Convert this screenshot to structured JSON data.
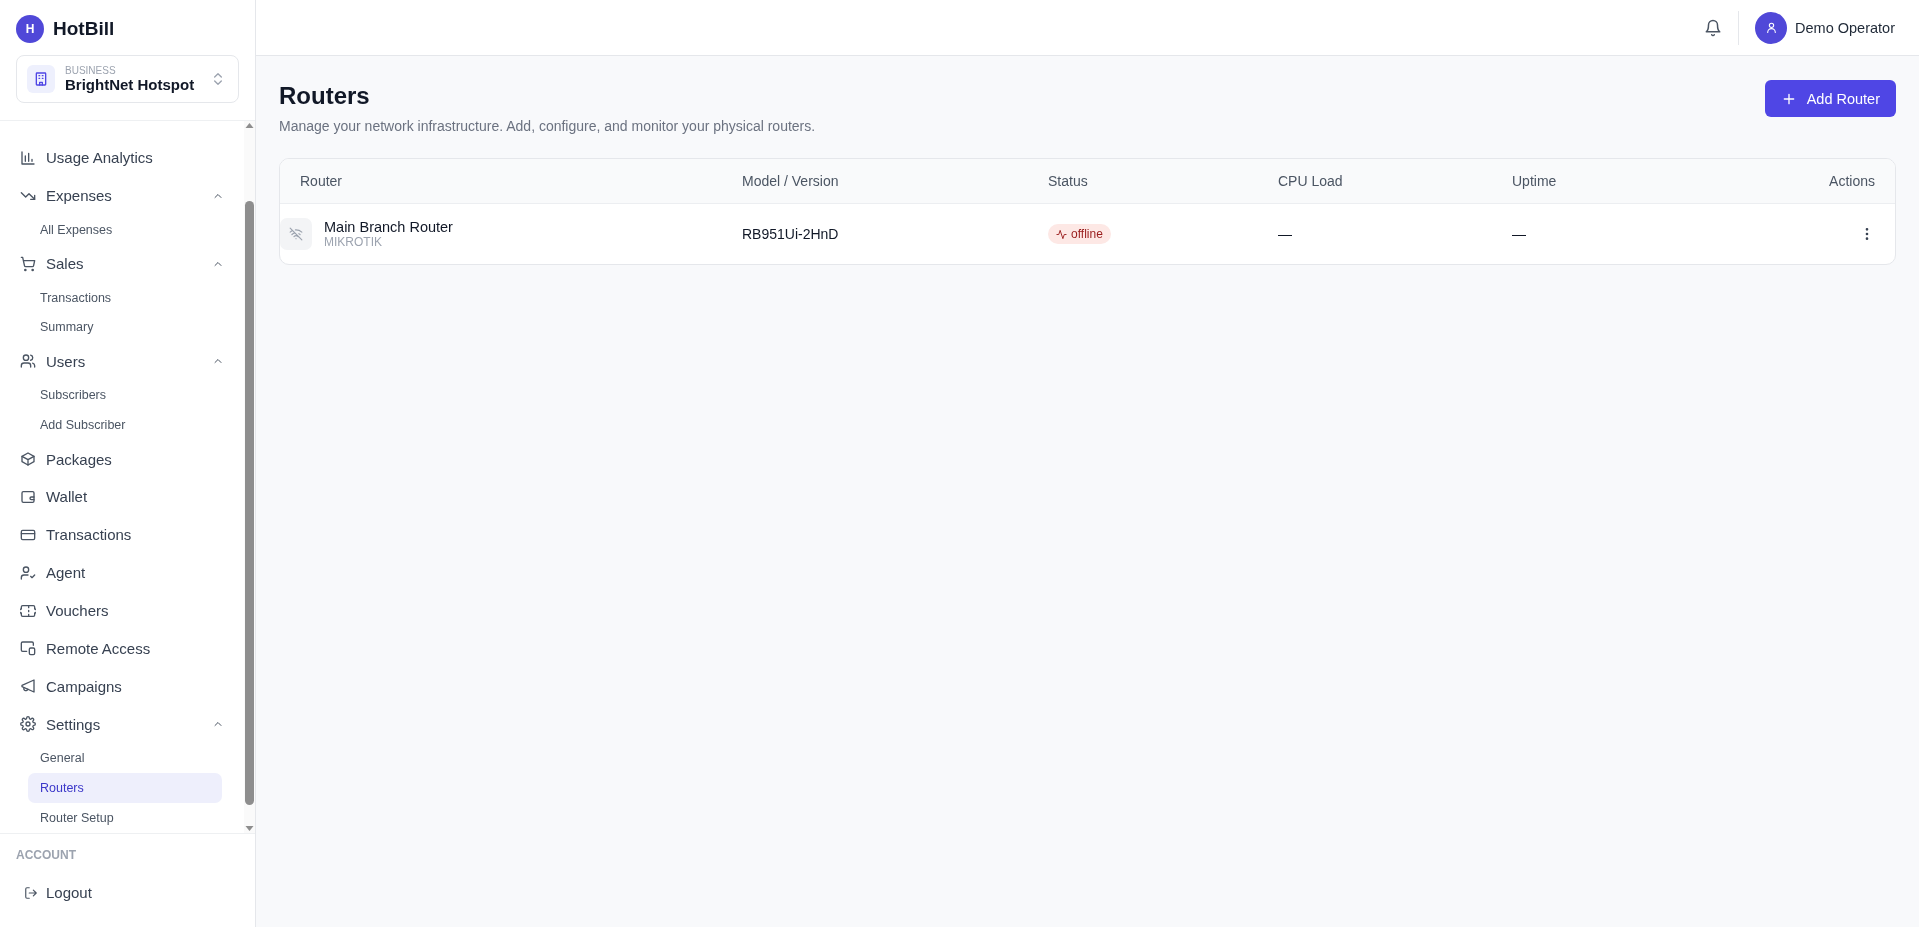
{
  "brand": {
    "logo_letter": "H",
    "name": "HotBill"
  },
  "business_switcher": {
    "label": "BUSINESS",
    "name": "BrightNet Hotspot"
  },
  "sidebar": {
    "items": [
      {
        "kind": "item",
        "label": "Usage Analytics",
        "selected": false
      },
      {
        "kind": "group",
        "label": "Expenses",
        "expanded": true,
        "children": [
          {
            "label": "All Expenses",
            "selected": false
          }
        ]
      },
      {
        "kind": "group",
        "label": "Sales",
        "expanded": true,
        "children": [
          {
            "label": "Transactions",
            "selected": false
          },
          {
            "label": "Summary",
            "selected": false
          }
        ]
      },
      {
        "kind": "group",
        "label": "Users",
        "expanded": true,
        "children": [
          {
            "label": "Subscribers",
            "selected": false
          },
          {
            "label": "Add Subscriber",
            "selected": false
          }
        ]
      },
      {
        "kind": "item",
        "label": "Packages",
        "selected": false
      },
      {
        "kind": "item",
        "label": "Wallet",
        "selected": false
      },
      {
        "kind": "item",
        "label": "Transactions",
        "selected": false
      },
      {
        "kind": "item",
        "label": "Agent",
        "selected": false
      },
      {
        "kind": "item",
        "label": "Vouchers",
        "selected": false
      },
      {
        "kind": "item",
        "label": "Remote Access",
        "selected": false
      },
      {
        "kind": "item",
        "label": "Campaigns",
        "selected": false
      },
      {
        "kind": "group",
        "label": "Settings",
        "expanded": true,
        "children": [
          {
            "label": "General",
            "selected": false
          },
          {
            "label": "Routers",
            "selected": true
          },
          {
            "label": "Router Setup",
            "selected": false
          }
        ]
      }
    ],
    "account": {
      "heading": "ACCOUNT",
      "logout": "Logout"
    }
  },
  "header": {
    "user_name": "Demo Operator"
  },
  "page": {
    "title": "Routers",
    "subtitle": "Manage your network infrastructure. Add, configure, and monitor your physical routers.",
    "add_button": "Add Router"
  },
  "table": {
    "columns": [
      "Router",
      "Model / Version",
      "Status",
      "CPU Load",
      "Uptime",
      "Actions"
    ],
    "rows": [
      {
        "name": "Main Branch Router",
        "vendor": "MIKROTIK",
        "model": "RB951Ui-2HnD",
        "status": "offline",
        "cpu_load": "—",
        "uptime": "—"
      }
    ]
  }
}
